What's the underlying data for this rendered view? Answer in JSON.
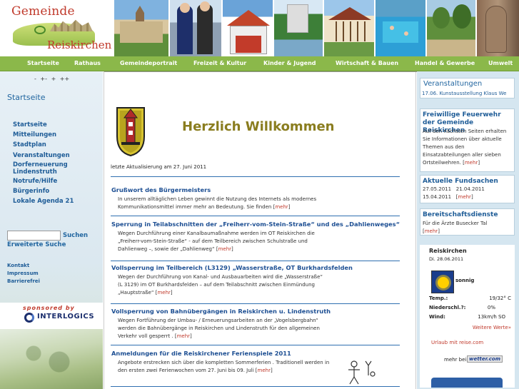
{
  "header": {
    "logo_line1": "Gemeinde",
    "logo_line2": "Reiskirchen"
  },
  "nav": {
    "items": [
      "Startseite",
      "Rathaus",
      "Gemeindeportrait",
      "Freizeit & Kultur",
      "Kinder & Jugend",
      "Wirtschaft & Bauen",
      "Handel & Gewerbe",
      "Umwelt"
    ]
  },
  "left": {
    "font_sizes": "- +- + ++",
    "title": "Startseite",
    "menu": [
      "Startseite",
      "Mitteilungen",
      "Stadtplan",
      "Veranstaltungen",
      "Dorferneuerung Lindenstruth",
      "Notrufe/Hilfe",
      "Bürgerinfo",
      "Lokale Agenda 21"
    ],
    "search_button": "Suchen",
    "advanced_search": "Erweiterte Suche",
    "service_links": [
      "Kontakt",
      "Impressum",
      "Barrierefrei"
    ],
    "sponsor_label": "sponsored by",
    "sponsor_name": "INTERLOGICS"
  },
  "main": {
    "welcome": "Herzlich Willkommen",
    "updated": "letzte Aktualisierung am 27. Juni 2011",
    "more_label": "mehr",
    "news": [
      {
        "title": "Grußwort des Bürgermeisters",
        "text": "In unserem alltäglichen Leben gewinnt die Nutzung des Internets als modernes Kommunikationsmittel immer mehr an Bedeutung. Sie finden"
      },
      {
        "title": "Sperrung in Teilabschnitten der „Freiherr-vom-Stein-Straße“ und des „Dahlienweges“",
        "text": "Wegen Durchführung einer Kanalbaumaßnahme werden im OT Reiskirchen die „Freiherr-vom-Stein-Straße“ - auf dem Teilbereich zwischen Schulstraße und Dahlienweg –, sowie der „Dahlienweg“"
      },
      {
        "title": "Vollsperrung im Teilbereich (L3129) „Wasserstraße, OT Burkhardsfelden",
        "text": "Wegen der Durchführung von Kanal- und Ausbauarbeiten wird die „Wasserstraße“ (L 3129) im OT Burkhardsfelden – auf dem Teilabschnitt zwischen Einmündung „Hauptstraße“"
      },
      {
        "title": "Vollsperrung von Bahnübergängen in Reiskirchen u. Lindenstruth",
        "text": "Wegen Fortführung der Umbau- / Erneuerungsarbeiten an der „Vogelsbergbahn“ werden die Bahnübergänge in Reiskirchen und Lindenstruth für den allgemeinen Verkehr voll gesperrt ."
      },
      {
        "title": "Anmeldungen für die Reiskirchener Ferienspiele 2011",
        "text": "Angebote erstrecken sich über die kompletten Sommerferien . Traditionell werden in den ersten zwei Ferienwochen vom 27. Juni bis 09. Juli"
      }
    ]
  },
  "right": {
    "events_title": "Veranstaltungen",
    "events_item": "17.06. Kunstausstellung Klaus We",
    "fire_title": "Freiwillige Feuerwehr der Gemeinde Reiskirchen",
    "fire_text": "Auf den nächsten Seiten erhalten Sie Informationen über aktuelle Themen aus den Einsatzabteilungen aller sieben Ortsteilwehren.",
    "found_title": "Aktuelle Fundsachen",
    "found_line1": "27.05.2011   21.04.2011",
    "found_line2": "15.04.2011",
    "duty_title": "Bereitschaftsdienste",
    "duty_text": "Für die Ärzte Busecker Tal",
    "more_label": "mehr",
    "weather": {
      "place": "Reiskirchen",
      "date": "Di. 28.06.2011",
      "condition": "sonnig",
      "rows": [
        {
          "label": "Temp.:",
          "value": "19/32° C"
        },
        {
          "label": "Niederschl.?:",
          "value": "0%"
        },
        {
          "label": "Wind:",
          "value": "13km/h SO"
        }
      ],
      "more_link": "Weitere Werte»",
      "travel_link": "Urlaub mit reise.com",
      "more_at": "mehr bei",
      "provider": "wetter.com"
    }
  },
  "colors": {
    "nav_green": "#8bb84a",
    "link_blue": "#1e5c97",
    "welcome_olive": "#8a7d1f",
    "accent_red": "#c0392b"
  }
}
